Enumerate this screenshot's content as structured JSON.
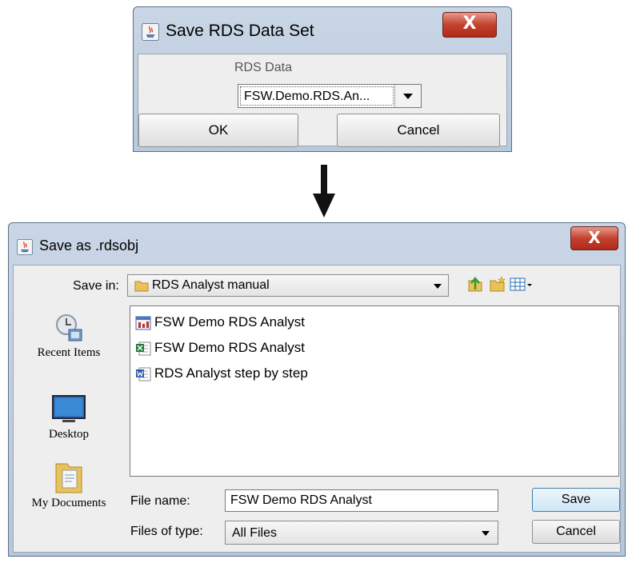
{
  "dialog1": {
    "title": "Save RDS Data Set",
    "close_label": "X",
    "rds_label": "RDS Data",
    "combo_value": "FSW.Demo.RDS.An...",
    "ok_label": "OK",
    "cancel_label": "Cancel"
  },
  "dialog2": {
    "title": "Save as .rdsobj",
    "close_label": "X",
    "save_in_label": "Save in:",
    "save_in_value": "RDS Analyst manual",
    "places": [
      {
        "label": "Recent Items",
        "icon": "recent-items-icon"
      },
      {
        "label": "Desktop",
        "icon": "desktop-icon"
      },
      {
        "label": "My Documents",
        "icon": "my-documents-icon"
      }
    ],
    "files": [
      {
        "name": "FSW Demo RDS Analyst",
        "icon": "rds-file-icon"
      },
      {
        "name": "FSW Demo RDS Analyst",
        "icon": "excel-file-icon"
      },
      {
        "name": "RDS Analyst step by step",
        "icon": "word-file-icon"
      }
    ],
    "file_name_label": "File name:",
    "file_name_value": "FSW Demo RDS Analyst",
    "files_of_type_label": "Files of type:",
    "files_of_type_value": "All Files",
    "save_label": "Save",
    "cancel_label": "Cancel"
  }
}
